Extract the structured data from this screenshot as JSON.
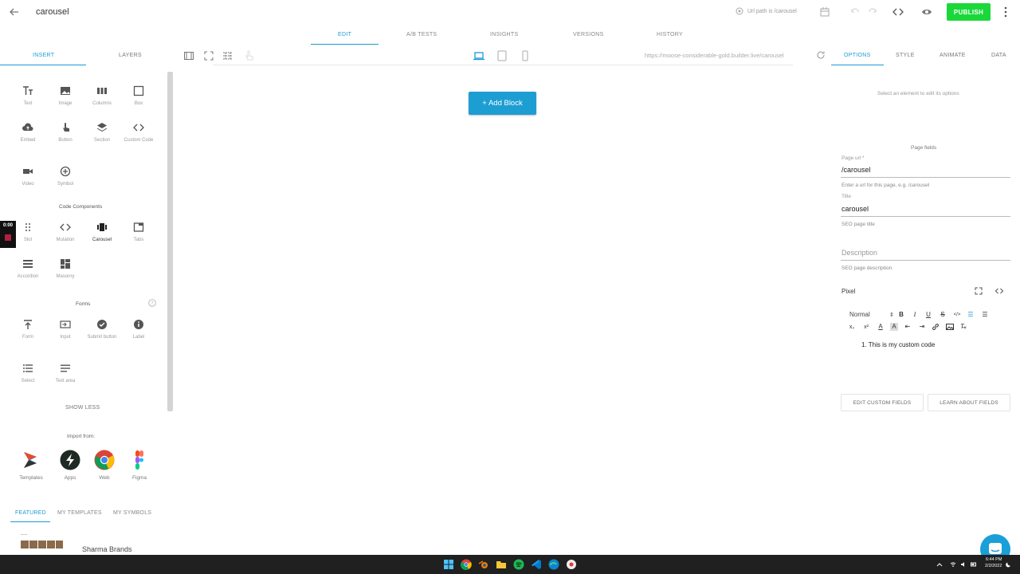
{
  "topbar": {
    "page_name": "carousel",
    "url_path_label": "Url path is /carousel",
    "publish_label": "PUBLISH"
  },
  "main_tabs": [
    "EDIT",
    "A/B TESTS",
    "INSIGHTS",
    "VERSIONS",
    "HISTORY"
  ],
  "left_panel": {
    "tabs": [
      "INSERT",
      "LAYERS"
    ],
    "blocks": [
      "Text",
      "Image",
      "Columns",
      "Box",
      "Embed",
      "Button",
      "Section",
      "Custom Code",
      "Video",
      "Symbol"
    ],
    "code_components_title": "Code Components",
    "code_components": [
      "Slot",
      "Mutation",
      "Carousel",
      "Tabs",
      "Accordion",
      "Masonry"
    ],
    "forms_title": "Forms",
    "forms": [
      "Form",
      "Input",
      "Submit button",
      "Label",
      "Select",
      "Text area"
    ],
    "show_less": "SHOW LESS",
    "import_from_title": "Import from:",
    "import_sources": [
      "Templates",
      "Apps",
      "Web",
      "Figma"
    ],
    "bottom_tabs": [
      "FEATURED",
      "MY TEMPLATES",
      "MY SYMBOLS"
    ],
    "featured_template": "Sharma Brands",
    "timer": "0:00"
  },
  "canvas": {
    "url": "https://moose-considerable-gold.builder.live/carousel",
    "add_block_label": "+ Add Block"
  },
  "right_panel": {
    "tabs": [
      "OPTIONS",
      "STYLE",
      "ANIMATE",
      "DATA"
    ],
    "select_hint": "Select an element to edit its options",
    "page_fields_title": "Page fields",
    "page_url_label": "Page url *",
    "page_url_value": "/carousel",
    "page_url_help": "Enter a url for this page, e.g. /carousel",
    "title_label": "Title",
    "title_value": "carousel",
    "title_help": "SEO page title",
    "description_placeholder": "Description",
    "description_help": "SEO page description",
    "pixel_label": "Pixel",
    "rte_format": "Normal",
    "code_content": "1. This is my custom code",
    "edit_custom_fields": "EDIT CUSTOM FIELDS",
    "learn_about_fields": "LEARN ABOUT FIELDS"
  },
  "taskbar": {
    "time": "6:44 PM",
    "date": "2/2/2022"
  },
  "colors": {
    "accent": "#1c9ad6",
    "publish": "#1bd83a",
    "add_block": "#1d9ed3"
  }
}
